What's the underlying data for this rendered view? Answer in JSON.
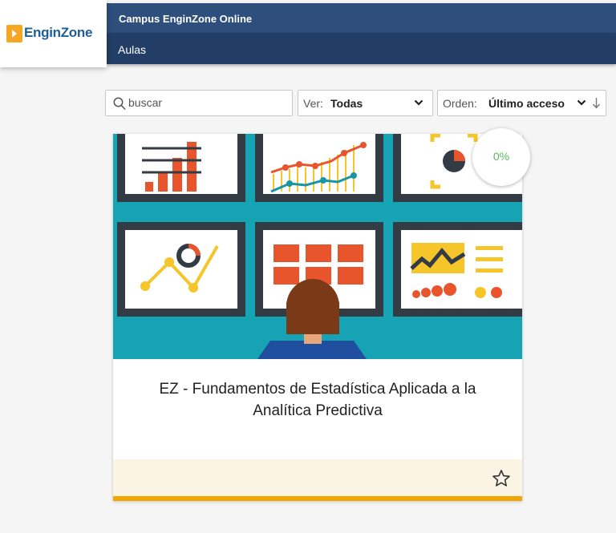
{
  "brand": {
    "name": "EnginZone",
    "icon": "enginzone-logo"
  },
  "header": {
    "title": "Campus EnginZone Online",
    "nav": "Aulas"
  },
  "filters": {
    "search_placeholder": "buscar",
    "search_icon": "search-icon",
    "view_label": "Ver:",
    "view_value": "Todas",
    "order_label": "Orden:",
    "order_value": "Último acceso",
    "order_direction_icon": "arrow-down-icon"
  },
  "course": {
    "title": "EZ - Fundamentos de Estadística Aplicada a la Analítica Predictiva",
    "progress_text": "0%",
    "progress": 0,
    "favorite_icon": "star-outline-icon",
    "accent": "#f0a500"
  },
  "colors": {
    "topbar": "#2e4e7c",
    "subbar": "#223e66",
    "image_bg": "#16a3b4",
    "progress_text": "#5cb85c"
  }
}
